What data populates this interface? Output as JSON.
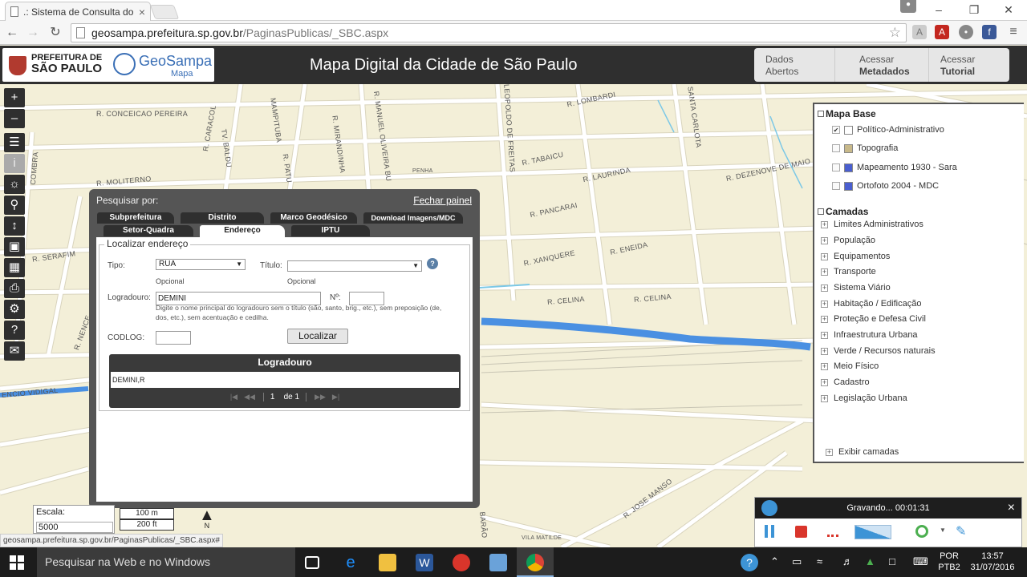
{
  "browser": {
    "tab_title": ".: Sistema de Consulta do",
    "tab_close": "×",
    "url_host": "geosampa.prefeitura.sp.gov.br",
    "url_path": "/PaginasPublicas/_SBC.aspx",
    "status_url": "geosampa.prefeitura.sp.gov.br/PaginasPublicas/_SBC.aspx#"
  },
  "header": {
    "logo_line1": "PREFEITURA DE",
    "logo_line2": "SÃO PAULO",
    "geosampa": "GeoSampa",
    "geosampa_sub": "Mapa",
    "title": "Mapa Digital da Cidade de São Paulo",
    "menu": [
      {
        "line1": "Dados",
        "line2": "Abertos"
      },
      {
        "line1": "Acessar",
        "line2": "Metadados"
      },
      {
        "line1": "Acessar",
        "line2": "Tutorial"
      }
    ]
  },
  "map": {
    "streets": [
      "R. CONCEICAO PEREIRA",
      "R. CARACOL",
      "R. MOLITERNO",
      "R. SERAFIM",
      "R. NENCE",
      "ENCIO VIDIGAL",
      "R. LOMBARDI",
      "R. TABAICU",
      "R. LAURINDA",
      "R. DEZENOVE DE MAIO",
      "R. PANCARAI",
      "R. XANQUERE",
      "R. ENEIDA",
      "R. CELINA",
      "R. CELINA",
      "MAMPITUBA",
      "R. MIRANDINHA",
      "R. MANUEL OLIVEIRA BU",
      "LEOPOLDO DE FREITAS",
      "R. SANTA CARLOTA",
      "PENHA",
      "R. JOSE MANSO",
      "VILA MATILDE",
      "BARÃO",
      "COMBRA",
      "TV. BALDU",
      "R. PATU"
    ],
    "scale_label": "Escala:",
    "scale_value": "5000",
    "scale_bar_m": "100 m",
    "scale_bar_ft": "200 ft",
    "north": "N"
  },
  "search_panel": {
    "title": "Pesquisar por:",
    "close": "Fechar painel",
    "tabs_row1": [
      "Subprefeitura",
      "Distrito",
      "Marco Geodésico",
      "Download Imagens/MDC"
    ],
    "tabs_row2": [
      "Setor-Quadra",
      "Endereço",
      "IPTU"
    ],
    "active_tab": "Endereço",
    "legend": "Localizar endereço",
    "tipo_label": "Tipo:",
    "tipo_value": "RUA",
    "tipo_note": "Opcional",
    "titulo_label": "Título:",
    "titulo_value": "",
    "titulo_note": "Opcional",
    "help": "?",
    "logradouro_label": "Logradouro:",
    "logradouro_value": "DEMINI",
    "numero_label": "Nº:",
    "numero_value": "",
    "hint": "Digite o nome principal do logradouro sem o título (são, santo, brig., etc.), sem preposição (de, dos, etc.), sem acentuação e cedilha.",
    "codlog_label": "CODLOG:",
    "codlog_value": "",
    "button": "Localizar",
    "results_header": "Logradouro",
    "results": [
      "DEMINI,R"
    ],
    "page": "1",
    "page_of": "de 1"
  },
  "layers": {
    "base_title": "Mapa Base",
    "base_items": [
      {
        "label": "Político-Administrativo",
        "checked": true,
        "color": "#ffffff"
      },
      {
        "label": "Topografia",
        "checked": false,
        "color": "#c8b98a"
      },
      {
        "label": "Mapeamento 1930 - Sara",
        "checked": false,
        "color": "#4a5fd0"
      },
      {
        "label": "Ortofoto 2004 - MDC",
        "checked": false,
        "color": "#4a5fd0"
      }
    ],
    "camadas_title": "Camadas",
    "camadas": [
      "Limites Administrativos",
      "População",
      "Equipamentos",
      "Transporte",
      "Sistema Viário",
      "Habitação / Edificação",
      "Proteção e Defesa Civil",
      "Infraestrutura Urbana",
      "Verde / Recursos naturais",
      "Meio Físico",
      "Cadastro",
      "Legislação Urbana"
    ],
    "exibir": "Exibir camadas"
  },
  "recorder": {
    "status": "Gravando... 00:01:31",
    "close": "×"
  },
  "taskbar": {
    "search": "Pesquisar na Web e no Windows",
    "lang1": "POR",
    "lang2": "PTB2",
    "time": "13:57",
    "date": "31/07/2016"
  },
  "colors": {
    "header_bg": "#2f2f2f",
    "river": "#4a90e2",
    "map_bg": "#f3efd8"
  }
}
